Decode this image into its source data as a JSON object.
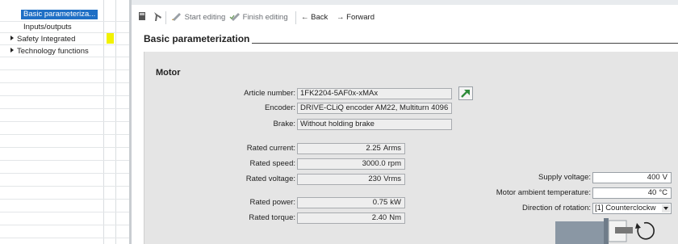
{
  "tree": {
    "items": [
      {
        "label": "Basic parameteriza...",
        "selected": true,
        "expandable": false
      },
      {
        "label": "Inputs/outputs",
        "selected": false,
        "expandable": false
      },
      {
        "label": "Safety Integrated",
        "selected": false,
        "expandable": true
      },
      {
        "label": "Technology functions",
        "selected": false,
        "expandable": true
      }
    ]
  },
  "toolbar": {
    "start_editing": "Start editing",
    "finish_editing": "Finish editing",
    "back": "Back",
    "forward": "Forward"
  },
  "section": {
    "title": "Basic parameterization"
  },
  "motor": {
    "title": "Motor",
    "article_number_label": "Article number:",
    "article_number_value": "1FK2204-5AF0x-xMAx",
    "encoder_label": "Encoder:",
    "encoder_value": "DRIVE-CLiQ encoder AM22, Multiturn 4096",
    "brake_label": "Brake:",
    "brake_value": "Without holding brake",
    "rated_current_label": "Rated current:",
    "rated_current_value": "2.25",
    "rated_current_unit": "Arms",
    "rated_speed_label": "Rated speed:",
    "rated_speed_value": "3000.0",
    "rated_speed_unit": "rpm",
    "rated_voltage_label": "Rated voltage:",
    "rated_voltage_value": "230",
    "rated_voltage_unit": "Vrms",
    "rated_power_label": "Rated power:",
    "rated_power_value": "0.75",
    "rated_power_unit": "kW",
    "rated_torque_label": "Rated torque:",
    "rated_torque_value": "2.40",
    "rated_torque_unit": "Nm",
    "supply_voltage_label": "Supply voltage:",
    "supply_voltage_value": "400",
    "supply_voltage_unit": "V",
    "ambient_temp_label": "Motor ambient temperature:",
    "ambient_temp_value": "40",
    "ambient_temp_unit": "°C",
    "rotation_label": "Direction of rotation:",
    "rotation_value": "[1] Counterclockw"
  },
  "colors": {
    "selection": "#1f6fc5",
    "warning_flag": "#f2f200",
    "panel_bg": "#e5e5e5",
    "link_green": "#2e8b3a"
  },
  "icons": [
    "save-icon",
    "wrench-icon",
    "pencil-icon",
    "pencil-check-icon",
    "back-arrow-icon",
    "forward-arrow-icon",
    "open-external-icon",
    "motor-rotation-icon",
    "dropdown-arrow-icon",
    "expand-arrow-icon"
  ]
}
